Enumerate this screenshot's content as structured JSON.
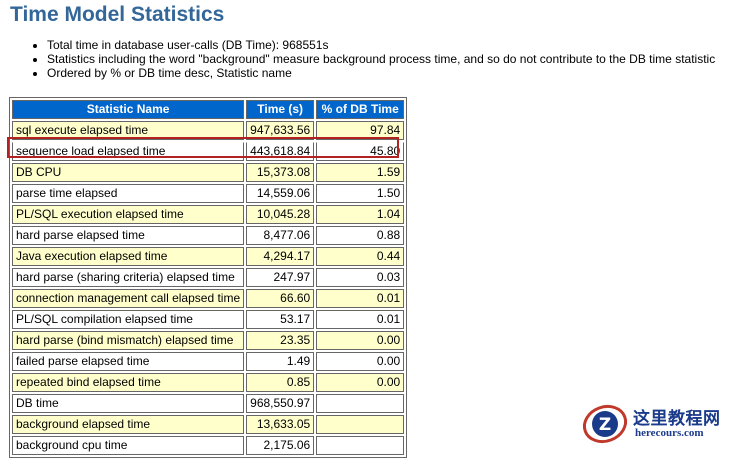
{
  "page": {
    "title": "Time Model Statistics",
    "notes": [
      "Total time in database user-calls (DB Time): 968551s",
      "Statistics including the word \"background\" measure background process time, and so do not contribute to the DB time statistic",
      "Ordered by % or DB time desc, Statistic name"
    ]
  },
  "table": {
    "headers": [
      "Statistic Name",
      "Time (s)",
      "% of DB Time"
    ],
    "rows": [
      [
        "sql execute elapsed time",
        "947,633.56",
        "97.84"
      ],
      [
        "sequence load elapsed time",
        "443,618.84",
        "45.80"
      ],
      [
        "DB CPU",
        "15,373.08",
        "1.59"
      ],
      [
        "parse time elapsed",
        "14,559.06",
        "1.50"
      ],
      [
        "PL/SQL execution elapsed time",
        "10,045.28",
        "1.04"
      ],
      [
        "hard parse elapsed time",
        "8,477.06",
        "0.88"
      ],
      [
        "Java execution elapsed time",
        "4,294.17",
        "0.44"
      ],
      [
        "hard parse (sharing criteria) elapsed time",
        "247.97",
        "0.03"
      ],
      [
        "connection management call elapsed time",
        "66.60",
        "0.01"
      ],
      [
        "PL/SQL compilation elapsed time",
        "53.17",
        "0.01"
      ],
      [
        "hard parse (bind mismatch) elapsed time",
        "23.35",
        "0.00"
      ],
      [
        "failed parse elapsed time",
        "1.49",
        "0.00"
      ],
      [
        "repeated bind elapsed time",
        "0.85",
        "0.00"
      ],
      [
        "DB time",
        "968,550.97",
        ""
      ],
      [
        "background elapsed time",
        "13,633.05",
        ""
      ],
      [
        "background cpu time",
        "2,175.06",
        ""
      ]
    ]
  },
  "watermark": {
    "line1": "这里教程网",
    "line2": "herecours.com"
  },
  "colors": {
    "title": "#336699",
    "header_bg": "#0066CC",
    "odd_row": "#FFFFCC",
    "highlight_border": "#b22222"
  }
}
